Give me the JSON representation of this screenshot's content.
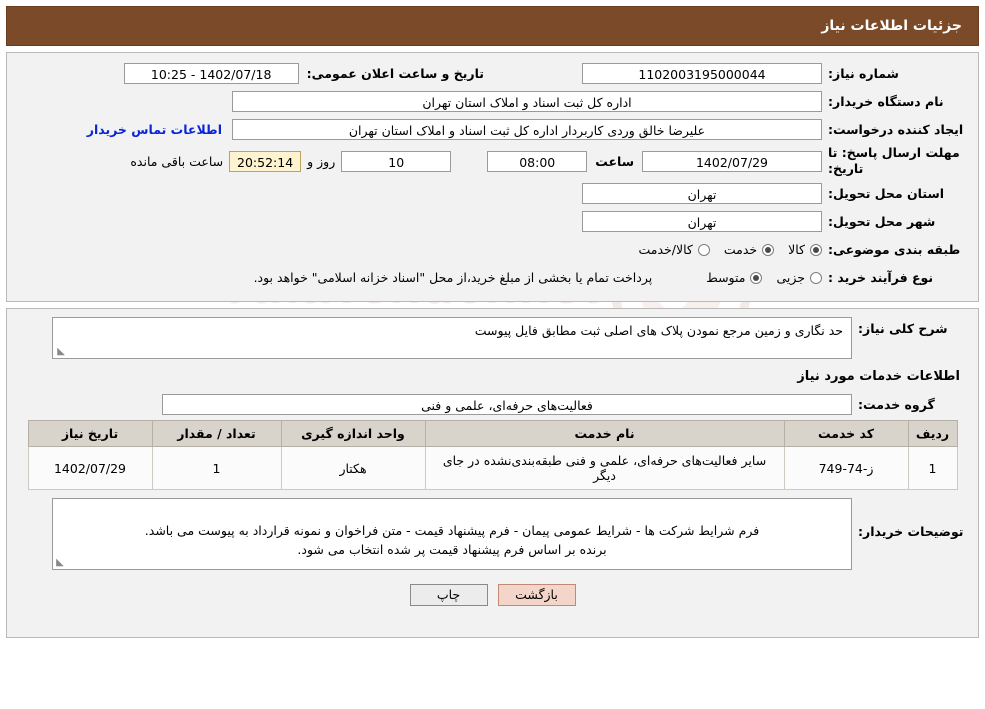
{
  "header": {
    "title": "جزئیات اطلاعات نیاز"
  },
  "form": {
    "need_number_label": "شماره نیاز:",
    "need_number_value": "1102003195000044",
    "announce_datetime_label": "تاریخ و ساعت اعلان عمومی:",
    "announce_datetime_value": "1402/07/18 - 10:25",
    "buyer_org_label": "نام دستگاه خریدار:",
    "buyer_org_value": "اداره کل ثبت اسناد و املاک استان تهران",
    "requester_label": "ایجاد کننده درخواست:",
    "requester_value": "علیرضا خالق وردی کاربردار اداره کل ثبت اسناد و املاک استان تهران",
    "contact_link": "اطلاعات تماس خریدار",
    "deadline_label": "مهلت ارسال پاسخ: تا تاریخ:",
    "deadline_date": "1402/07/29",
    "hour_label": "ساعت",
    "deadline_time": "08:00",
    "days_value": "10",
    "days_label": "روز و",
    "countdown_value": "20:52:14",
    "remaining_label": "ساعت باقی مانده",
    "delivery_province_label": "استان محل تحویل:",
    "delivery_province_value": "تهران",
    "delivery_city_label": "شهر محل تحویل:",
    "delivery_city_value": "تهران",
    "category_label": "طبقه بندی موضوعی:",
    "category_options": [
      {
        "label": "کالا",
        "selected": true
      },
      {
        "label": "خدمت",
        "selected": true
      },
      {
        "label": "کالا/خدمت",
        "selected": false
      }
    ],
    "purchase_type_label": "نوع فرآیند خرید :",
    "purchase_type_options": [
      {
        "label": "جزیی",
        "selected": false
      },
      {
        "label": "متوسط",
        "selected": true
      }
    ],
    "purchase_note": "پرداخت تمام یا بخشی از مبلغ خرید،از محل \"اسناد خزانه اسلامی\" خواهد بود."
  },
  "details": {
    "general_need_label": "شرح کلی نیاز:",
    "general_need_value": "حد نگاری و زمین مرجع نمودن پلاک های اصلی ثبت مطابق فایل پیوست",
    "services_section_title": "اطلاعات خدمات مورد نیاز",
    "service_group_label": "گروه خدمت:",
    "service_group_value": "فعالیت‌های حرفه‌ای، علمی و فنی",
    "table": {
      "columns": [
        "ردیف",
        "کد خدمت",
        "نام خدمت",
        "واحد اندازه گیری",
        "تعداد / مقدار",
        "تاریخ نیاز"
      ],
      "rows": [
        {
          "row": "1",
          "code": "ز-74-749",
          "name": "سایر فعالیت‌های حرفه‌ای، علمی و فنی طبقه‌بندی‌نشده در جای دیگر",
          "unit": "هکتار",
          "qty": "1",
          "date": "1402/07/29"
        }
      ]
    },
    "buyer_notes_label": "توضیحات خریدار:",
    "buyer_notes_value": "فرم شرایط شرکت ها - شرایط عمومی پیمان - فرم پیشنهاد قیمت - متن فراخوان و نمونه قرارداد به پیوست می باشد.\nبرنده بر اساس فرم پیشنهاد قیمت پر شده انتخاب می شود."
  },
  "buttons": {
    "print": "چاپ",
    "back": "بازگشت"
  },
  "watermark": {
    "text": "AnaTender.net"
  }
}
